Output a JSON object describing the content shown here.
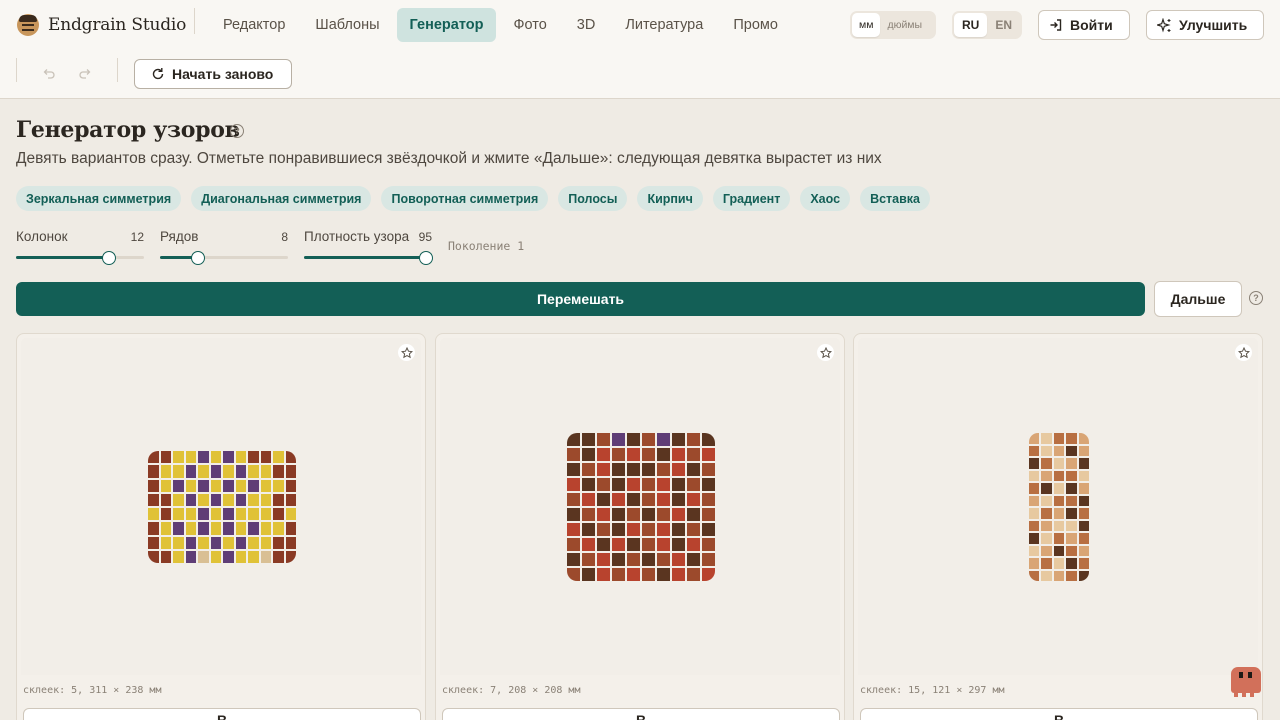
{
  "app": {
    "name": "Endgrain Studio"
  },
  "nav": {
    "tabs": [
      {
        "label": "Редактор"
      },
      {
        "label": "Шаблоны"
      },
      {
        "label": "Генератор",
        "active": true
      },
      {
        "label": "Фото"
      },
      {
        "label": "3D"
      },
      {
        "label": "Литература"
      },
      {
        "label": "Промо"
      }
    ]
  },
  "units": {
    "options": [
      "мм",
      "дюймы"
    ],
    "selected": "мм"
  },
  "lang": {
    "options": [
      "RU",
      "EN"
    ],
    "selected": "RU"
  },
  "header": {
    "login_label": "Войти",
    "upgrade_label": "Улучшить"
  },
  "toolbar": {
    "restart_label": "Начать заново"
  },
  "page": {
    "title": "Генератор узоров",
    "subtitle": "Девять вариантов сразу. Отметьте понравившиеся звёздочкой и жмите «Дальше»: следующая девятка вырастет из них"
  },
  "chips": [
    "Зеркальная симметрия",
    "Диагональная симметрия",
    "Поворотная симметрия",
    "Полосы",
    "Кирпич",
    "Градиент",
    "Хаос",
    "Вставка"
  ],
  "sliders": [
    {
      "label": "Колонок",
      "value": "12",
      "fraction": 0.73
    },
    {
      "label": "Рядов",
      "value": "8",
      "fraction": 0.3
    },
    {
      "label": "Плотность узора",
      "value": "95",
      "fraction": 0.95
    }
  ],
  "generation_label": "Поколение 1",
  "actions": {
    "shuffle_label": "Перемешать",
    "next_label": "Дальше"
  },
  "cards": [
    {
      "meta": "склеек: 5, 311 × 238 мм",
      "button_label": "В",
      "palette": [
        "#8a3a24",
        "#e0c237",
        "#5f3d76",
        "#d9bf94"
      ],
      "pattern": [
        "001121210010",
        "011212121100",
        "012121212110",
        "001212121100",
        "101121211101",
        "012121212110",
        "011212121100",
        "001231211300"
      ]
    },
    {
      "meta": "склеек: 7, 208 × 208 мм",
      "button_label": "В",
      "palette": [
        "#5a3520",
        "#9c4a2c",
        "#5f3d76",
        "#b8432e"
      ],
      "pattern": [
        "0012012010",
        "1031310313",
        "0130001301",
        "3010313010",
        "1303013031",
        "0130101301",
        "3010313010",
        "1303013031",
        "0130101301",
        "1031310313"
      ]
    },
    {
      "meta": "склеек: 15, 121 × 297 мм",
      "button_label": "В",
      "palette": [
        "#e7c9a0",
        "#b86f42",
        "#5a3520",
        "#d9a575"
      ],
      "pattern": [
        "30113",
        "10323",
        "21032",
        "03110",
        "12023",
        "30112",
        "01321",
        "13002",
        "20131",
        "03213",
        "31021",
        "10312"
      ]
    }
  ]
}
